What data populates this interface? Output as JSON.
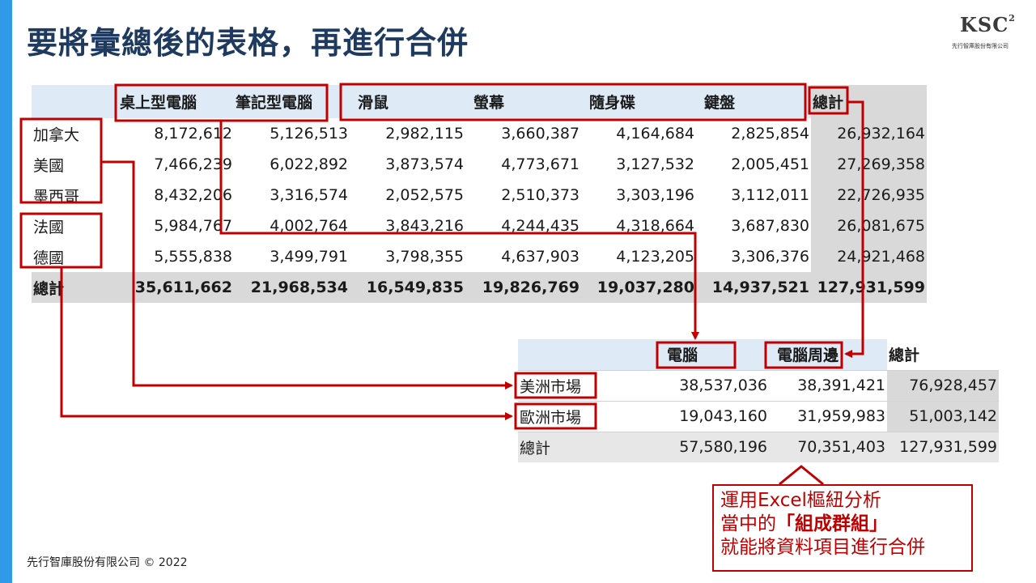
{
  "title": "要將彙總後的表格，再進行合併",
  "logo": {
    "mark": "KSC",
    "sup": "2",
    "sub": "先行智庫股份有限公司"
  },
  "footer": "先行智庫股份有限公司 © 2022",
  "table1": {
    "headers": [
      "",
      "桌上型電腦",
      "筆記型電腦",
      "滑鼠",
      "螢幕",
      "隨身碟",
      "鍵盤",
      "總計"
    ],
    "rows": [
      [
        "加拿大",
        "8,172,612",
        "5,126,513",
        "2,982,115",
        "3,660,387",
        "4,164,684",
        "2,825,854",
        "26,932,164"
      ],
      [
        "美國",
        "7,466,239",
        "6,022,892",
        "3,873,574",
        "4,773,671",
        "3,127,532",
        "2,005,451",
        "27,269,358"
      ],
      [
        "墨西哥",
        "8,432,206",
        "3,316,574",
        "2,052,575",
        "2,510,373",
        "3,303,196",
        "3,112,011",
        "22,726,935"
      ],
      [
        "法國",
        "5,984,767",
        "4,002,764",
        "3,843,216",
        "4,244,435",
        "4,318,664",
        "3,687,830",
        "26,081,675"
      ],
      [
        "德國",
        "5,555,838",
        "3,499,791",
        "3,798,355",
        "4,637,903",
        "4,123,205",
        "3,306,376",
        "24,921,468"
      ]
    ],
    "total": [
      "總計",
      "35,611,662",
      "21,968,534",
      "16,549,835",
      "19,826,769",
      "19,037,280",
      "14,937,521",
      "127,931,599"
    ]
  },
  "table2": {
    "headers": [
      "",
      "電腦",
      "電腦周邊",
      "總計"
    ],
    "rows": [
      [
        "美洲市場",
        "38,537,036",
        "38,391,421",
        "76,928,457"
      ],
      [
        "歐洲市場",
        "19,043,160",
        "31,959,983",
        "51,003,142"
      ]
    ],
    "total": [
      "總計",
      "57,580,196",
      "70,351,403",
      "127,931,599"
    ]
  },
  "note": {
    "line1": "運用Excel樞紐分析",
    "line2_pre": "當中的",
    "line2_bold": "「組成群組」",
    "line3": "就能將資料項目進行合併"
  },
  "colors": {
    "accent": "#2f9be8",
    "highlight": "#c00000",
    "title": "#1f3a5f",
    "header_fill": "#deebf7",
    "total_fill": "#d9d9d9"
  }
}
